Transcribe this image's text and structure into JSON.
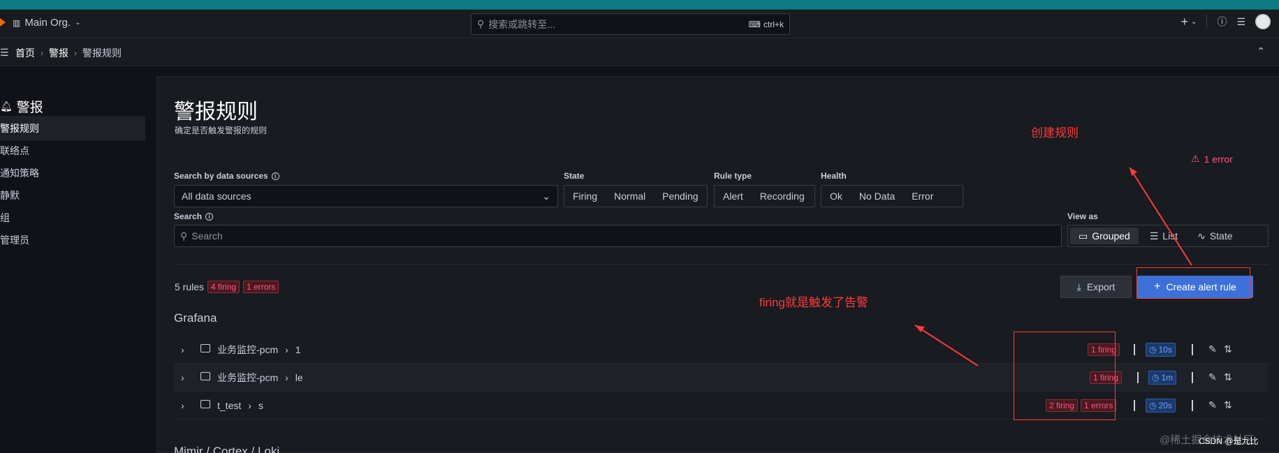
{
  "topbar": {
    "org": "Main Org.",
    "search_placeholder": "搜索或跳转至...",
    "shortcut": "ctrl+k"
  },
  "breadcrumb": [
    "首页",
    "警报",
    "警报规则"
  ],
  "sidenav": {
    "title": "警报",
    "items": [
      "警报规则",
      "联络点",
      "通知策略",
      "静默",
      "组",
      "管理员"
    ],
    "active": 0
  },
  "page": {
    "title": "警报规则",
    "subtitle": "确定是否触发警报的规则"
  },
  "filters": {
    "datasource_label": "Search by data sources",
    "datasource_value": "All data sources",
    "state_label": "State",
    "state_options": [
      "Firing",
      "Normal",
      "Pending"
    ],
    "ruletype_label": "Rule type",
    "ruletype_options": [
      "Alert",
      "Recording"
    ],
    "health_label": "Health",
    "health_options": [
      "Ok",
      "No Data",
      "Error"
    ],
    "search_label": "Search",
    "search_placeholder": "Search",
    "viewas_label": "View as",
    "viewas_options": [
      "Grouped",
      "List",
      "State"
    ]
  },
  "summary": {
    "rules": "5 rules",
    "firing": "4 firing",
    "errors": "1 errors"
  },
  "actions": {
    "export": "Export",
    "create": "Create alert rule"
  },
  "sections": [
    "Grafana",
    "Mimir / Cortex / Loki"
  ],
  "groups": [
    {
      "folder": "业务监控-pcm",
      "group": "1",
      "firing": "1 firing",
      "errors": "",
      "interval": "10s"
    },
    {
      "folder": "业务监控-pcm",
      "group": "le",
      "firing": "1 firing",
      "errors": "",
      "interval": "1m"
    },
    {
      "folder": "t_test",
      "group": "s",
      "firing": "2 firing",
      "errors": "1 errors",
      "interval": "20s"
    }
  ],
  "error_note": "1 error",
  "annotations": {
    "create": "创建规则",
    "firing": "firing就是触发了告警"
  },
  "watermark": "@稀土掘金技术社区",
  "watermark2": "CSDN @是九比"
}
